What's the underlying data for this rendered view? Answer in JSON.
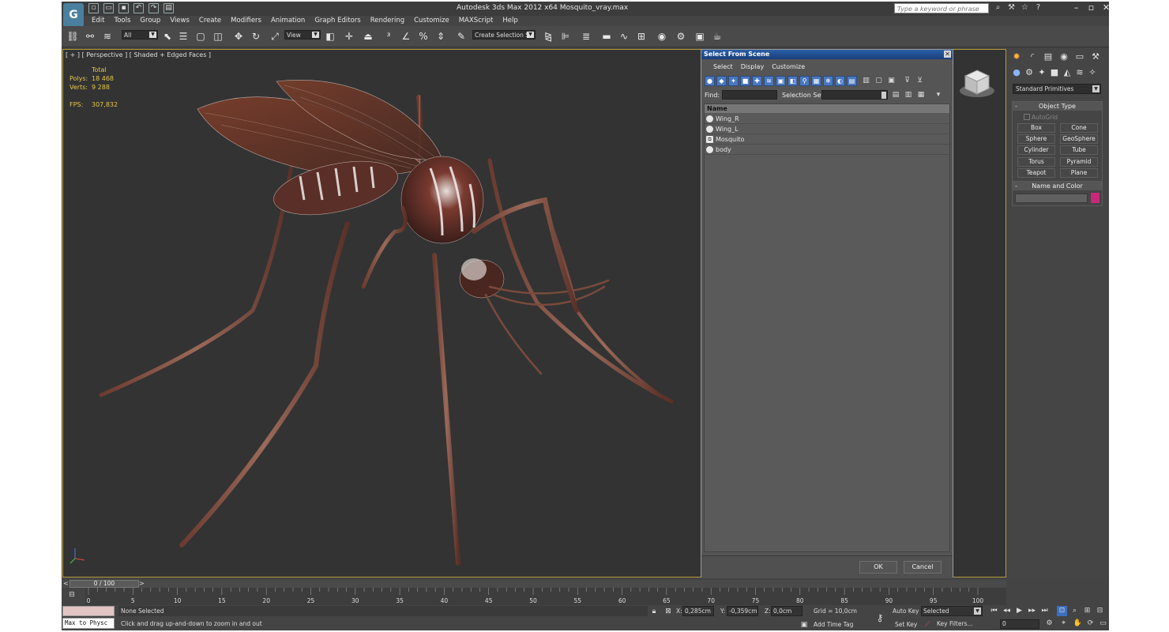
{
  "app": {
    "logo_glyph": "G",
    "title": "Autodesk 3ds Max  2012 x64     Mosquito_vray.max",
    "search_placeholder": "Type a keyword or phrase"
  },
  "menubar": [
    "Edit",
    "Tools",
    "Group",
    "Views",
    "Create",
    "Modifiers",
    "Animation",
    "Graph Editors",
    "Rendering",
    "Customize",
    "MAXScript",
    "Help"
  ],
  "toolbar": {
    "filter_value": "All",
    "refcoord_value": "View",
    "selection_set_value": "Create Selection Se"
  },
  "viewport": {
    "label": "[ + ] [ Perspective ] [ Shaded + Edged Faces ]",
    "stats": {
      "total_label": "Total",
      "polys_label": "Polys:",
      "polys_value": "18 468",
      "verts_label": "Verts:",
      "verts_value": "9 288",
      "fps_label": "FPS:",
      "fps_value": "307,832"
    }
  },
  "dialog": {
    "title": "Select From Scene",
    "menu": [
      "Select",
      "Display",
      "Customize"
    ],
    "find_label": "Find:",
    "selection_set_label": "Selection Set:",
    "column_header": "Name",
    "items": [
      "Wing_R",
      "Wing_L",
      "Mosquito",
      "body"
    ],
    "ok_label": "OK",
    "cancel_label": "Cancel"
  },
  "command_panel": {
    "category_value": "Standard Primitives",
    "object_type_title": "Object Type",
    "autogrid_label": "AutoGrid",
    "buttons": [
      "Box",
      "Cone",
      "Sphere",
      "GeoSphere",
      "Cylinder",
      "Tube",
      "Torus",
      "Pyramid",
      "Teapot",
      "Plane"
    ],
    "name_color_title": "Name and Color",
    "object_color": "#c8297a"
  },
  "timeline": {
    "slider_value": "0 / 100",
    "ticks": [
      "0",
      "5",
      "10",
      "15",
      "20",
      "25",
      "30",
      "35",
      "40",
      "45",
      "50",
      "55",
      "60",
      "65",
      "70",
      "75",
      "80",
      "85",
      "90",
      "95",
      "100"
    ]
  },
  "status": {
    "maxscript_text": "Max to Physc",
    "selection_text": "None Selected",
    "prompt_text": "Click and drag up-and-down to zoom in and out",
    "x_label": "X:",
    "x_value": "0,285cm",
    "y_label": "Y:",
    "y_value": "-0,359cm",
    "z_label": "Z:",
    "z_value": "0,0cm",
    "grid_text": "Grid = 10,0cm",
    "add_time_tag": "Add Time Tag",
    "auto_key": "Auto Key",
    "set_key": "Set Key",
    "selected_value": "Selected",
    "key_filters": "Key Filters...",
    "frame_value": "0"
  },
  "colors": {
    "accent_blue": "#2a5fa8",
    "viewport_border": "#b59a3c",
    "stat_text": "#e3c84a"
  }
}
